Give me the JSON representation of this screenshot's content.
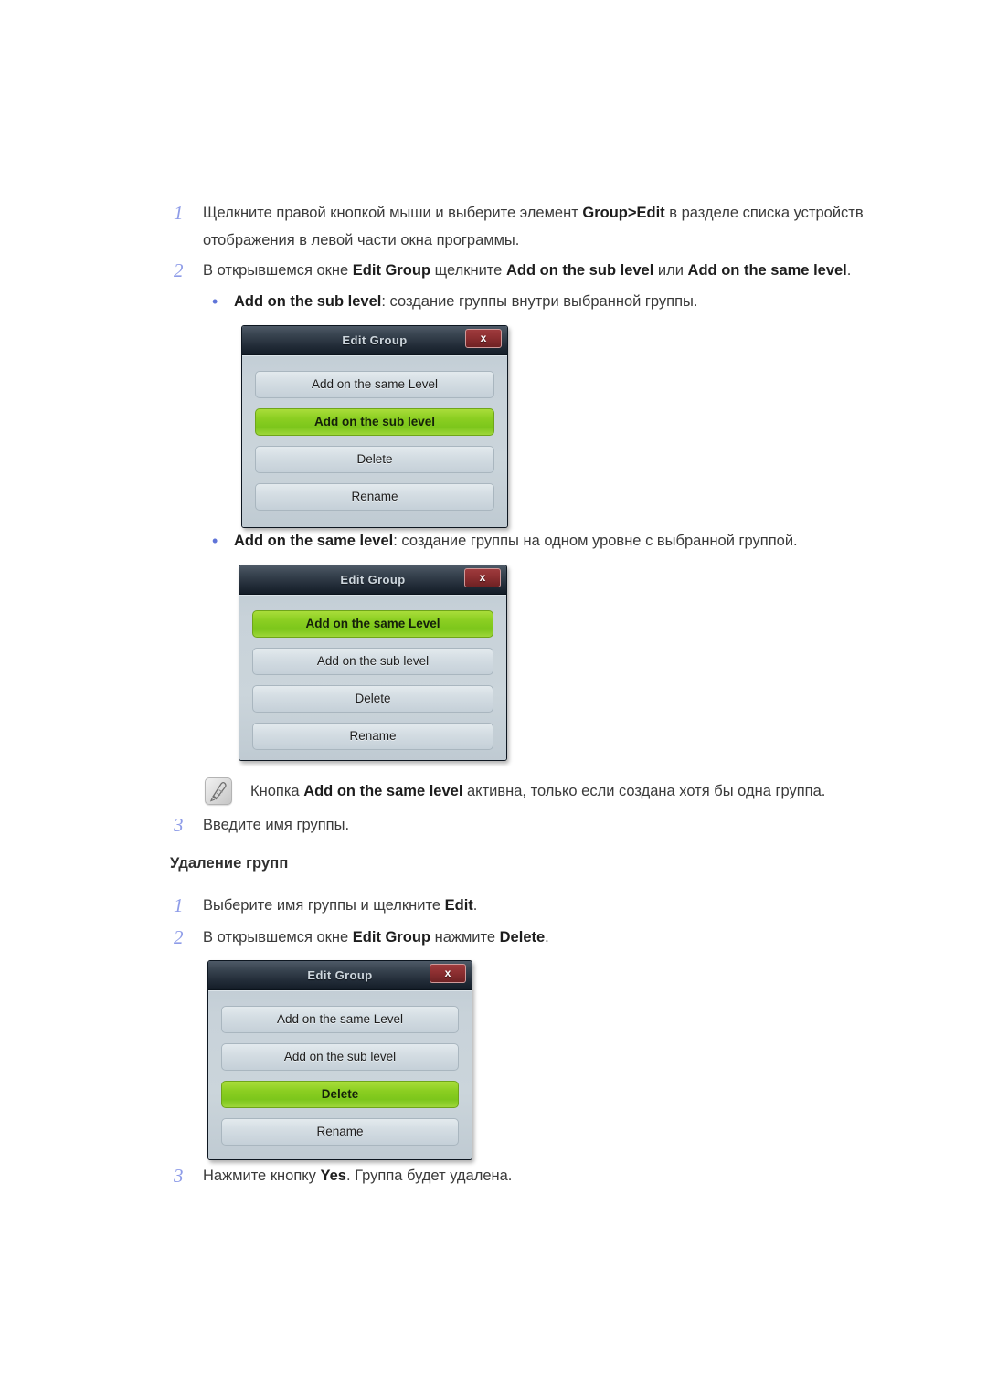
{
  "page": {
    "steps_top": [
      {
        "number": "1",
        "text_html": "Щелкните правой кнопкой мыши и выберите элемент <b>Group&gt;Edit</b> в разделе списка устройств отображения в левой части окна программы."
      },
      {
        "number": "2",
        "text_html": "В открывшемся окне <b>Edit Group</b> щелкните <b>Add on the sub level</b> или <b>Add on the same level</b>."
      }
    ],
    "bullets": [
      {
        "marker": "•",
        "text_html": "<b>Add on the sub level</b>: создание группы внутри выбранной группы."
      },
      {
        "marker": "•",
        "text_html": "<b>Add on the same level</b>: создание группы на одном уровне с выбранной группой."
      }
    ],
    "note": {
      "icon": "note-pen-icon",
      "text_html": "Кнопка <b>Add on the same level</b> активна, только если создана хотя бы одна группа."
    },
    "step_three_top": {
      "number": "3",
      "text_html": "Введите имя группы."
    },
    "section_heading": "Удаление групп",
    "steps_bottom": [
      {
        "number": "1",
        "text_html": "Выберите имя группы и щелкните <b>Edit</b>."
      },
      {
        "number": "2",
        "text_html": "В открывшемся окне <b>Edit Group</b> нажмите <b>Delete</b>."
      }
    ],
    "step_three_bottom": {
      "number": "3",
      "text_html": "Нажмите кнопку <b>Yes</b>. Группа будет удалена."
    }
  },
  "dialogs": [
    {
      "id": "dialog-sub-level",
      "title": "Edit Group",
      "close_label": "x",
      "buttons": [
        {
          "label": "Add on the same Level",
          "active": false
        },
        {
          "label": "Add on the sub level",
          "active": true
        },
        {
          "label": "Delete",
          "active": false
        },
        {
          "label": "Rename",
          "active": false
        }
      ]
    },
    {
      "id": "dialog-same-level",
      "title": "Edit Group",
      "close_label": "x",
      "buttons": [
        {
          "label": "Add on the same Level",
          "active": true
        },
        {
          "label": "Add on the sub level",
          "active": false
        },
        {
          "label": "Delete",
          "active": false
        },
        {
          "label": "Rename",
          "active": false
        }
      ]
    },
    {
      "id": "dialog-delete",
      "title": "Edit Group",
      "close_label": "x",
      "buttons": [
        {
          "label": "Add on the same Level",
          "active": false
        },
        {
          "label": "Add on the sub level",
          "active": false
        },
        {
          "label": "Delete",
          "active": true
        },
        {
          "label": "Rename",
          "active": false
        }
      ]
    }
  ],
  "colors": {
    "step_number": "#8e9ce8",
    "accent_green": "#8ccf22",
    "close_red": "#8d2f31",
    "title_bar_dark": "#222c38",
    "dialog_body": "#c8d2d9"
  }
}
